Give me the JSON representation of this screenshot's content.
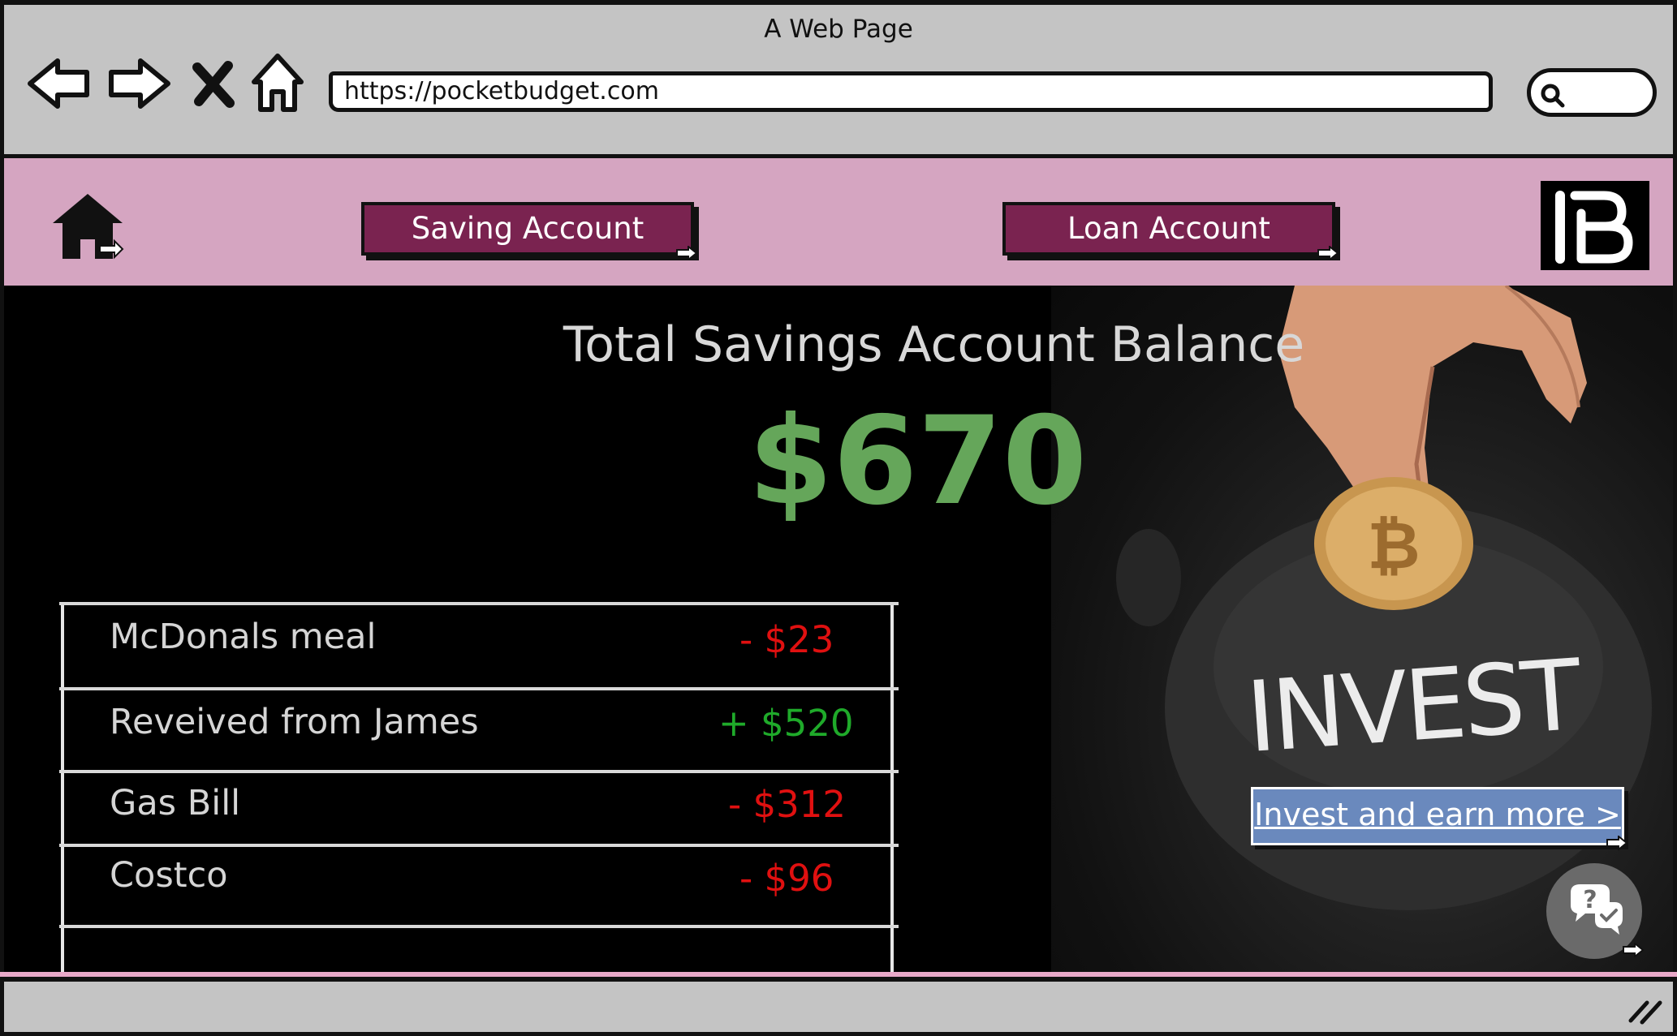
{
  "window": {
    "title": "A Web Page",
    "url": "https://pocketbudget.com"
  },
  "toolbar": {
    "back_icon": "arrow-left-icon",
    "forward_icon": "arrow-right-icon",
    "stop_icon": "close-icon",
    "home_icon": "home-icon",
    "search_icon": "search-icon"
  },
  "header": {
    "home_icon": "home-icon",
    "tabs": [
      {
        "label": "Saving Account"
      },
      {
        "label": "Loan Account"
      }
    ],
    "logo_text": "PB",
    "colors": {
      "background": "#d5a5c1",
      "tab": "#7a2350"
    }
  },
  "balance": {
    "title": "Total Savings Account Balance",
    "amount": "$670",
    "color": "#65a65a"
  },
  "transactions": [
    {
      "description": "McDonals meal",
      "amount": "- $23",
      "type": "debit"
    },
    {
      "description": "Reveived from James",
      "amount": "+ $520",
      "type": "credit"
    },
    {
      "description": "Gas Bill",
      "amount": "- $312",
      "type": "debit"
    },
    {
      "description": "Costco",
      "amount": "- $96",
      "type": "debit"
    }
  ],
  "hero": {
    "image_text": "INVEST",
    "coin_symbol": "₿"
  },
  "cta": {
    "label": "Invest and earn more >",
    "color": "#6a89bd"
  },
  "chat": {
    "icon": "chat-help-icon"
  }
}
